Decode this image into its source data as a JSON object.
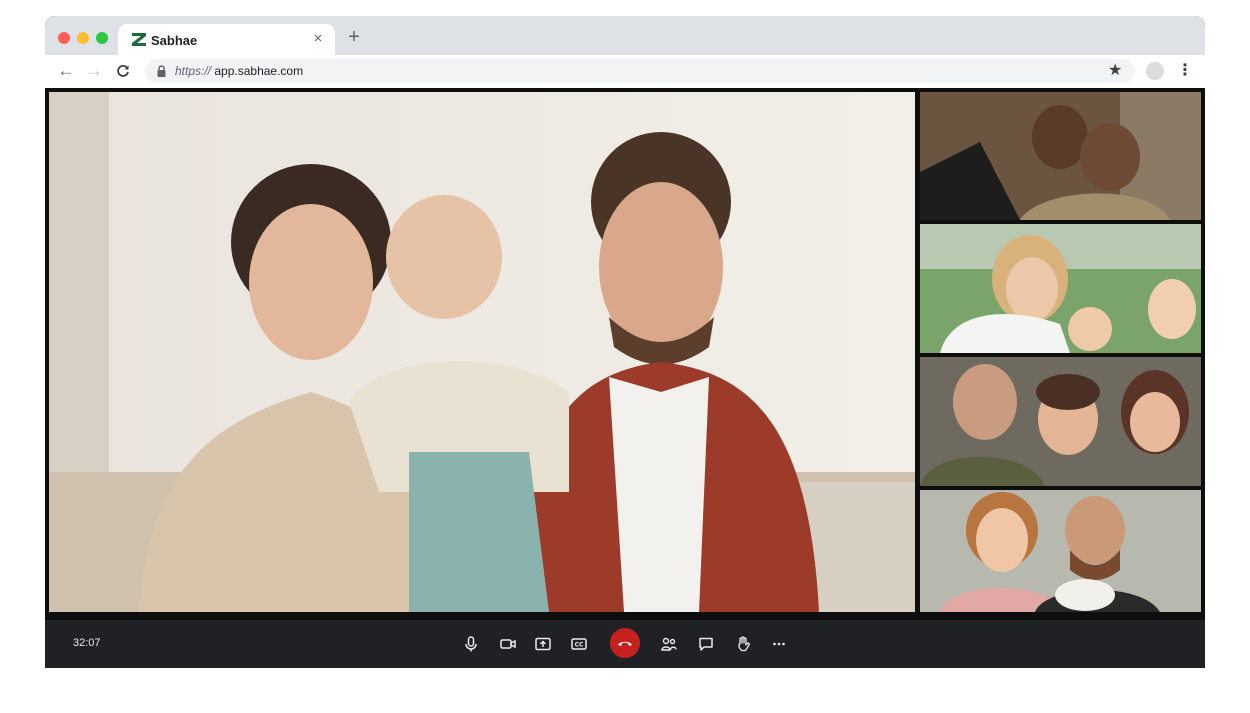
{
  "browser": {
    "tab_title": "Sabhae",
    "tab_close": "×",
    "new_tab": "+",
    "url_scheme": "https://",
    "url_host": "app.sabhae.com"
  },
  "meeting": {
    "elapsed": "32:07"
  },
  "colors": {
    "brand": "#1c6b3c",
    "end_call": "#c5221f",
    "control_bar": "#202124"
  },
  "icons": [
    "microphone-icon",
    "camera-icon",
    "share-screen-icon",
    "captions-icon",
    "end-call-icon",
    "participants-icon",
    "chat-icon",
    "raise-hand-icon",
    "more-icon"
  ]
}
